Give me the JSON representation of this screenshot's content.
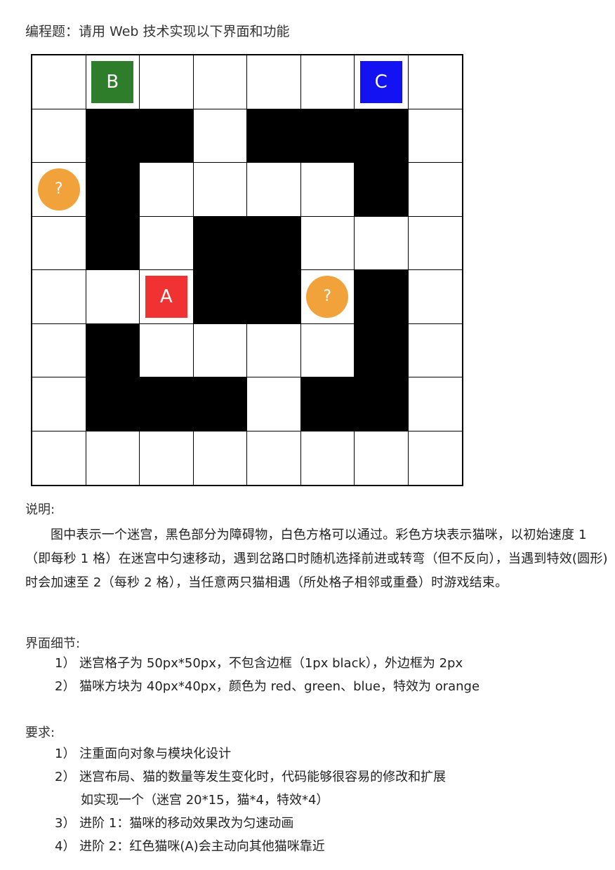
{
  "title": "编程题：请用 Web 技术实现以下界面和功能",
  "maze": {
    "rows": 8,
    "cols": 8,
    "walls": [
      [
        1,
        1
      ],
      [
        1,
        2
      ],
      [
        1,
        4
      ],
      [
        1,
        5
      ],
      [
        1,
        6
      ],
      [
        2,
        1
      ],
      [
        2,
        6
      ],
      [
        3,
        1
      ],
      [
        3,
        3
      ],
      [
        3,
        4
      ],
      [
        4,
        3
      ],
      [
        4,
        4
      ],
      [
        4,
        6
      ],
      [
        5,
        1
      ],
      [
        5,
        6
      ],
      [
        6,
        1
      ],
      [
        6,
        2
      ],
      [
        6,
        3
      ],
      [
        6,
        5
      ],
      [
        6,
        6
      ]
    ],
    "cats": [
      {
        "label": "B",
        "color": "#2E7D2A",
        "row": 0,
        "col": 1
      },
      {
        "label": "C",
        "color": "#1212F2",
        "row": 0,
        "col": 6
      },
      {
        "label": "A",
        "color": "#F03232",
        "row": 4,
        "col": 2
      }
    ],
    "effects": [
      {
        "label": "?",
        "color": "#F1A23A",
        "row": 2,
        "col": 0
      },
      {
        "label": "?",
        "color": "#F1A23A",
        "row": 4,
        "col": 5
      }
    ]
  },
  "description": {
    "heading": "说明:",
    "text": "图中表示一个迷宫，黑色部分为障碍物，白色方格可以通过。彩色方块表示猫咪，以初始速度 1（即每秒 1 格）在迷宫中匀速移动，遇到岔路口时随机选择前进或转弯（但不反向），当遇到特效(圆形)时会加速至 2（每秒 2 格），当任意两只猫相遇（所处格子相邻或重叠）时游戏结束。"
  },
  "ui_details": {
    "heading": "界面细节:",
    "items": [
      "1） 迷宫格子为 50px*50px，不包含边框（1px black），外边框为 2px",
      "2） 猫咪方块为 40px*40px，颜色为 red、green、blue，特效为 orange"
    ]
  },
  "requirements": {
    "heading": "要求:",
    "items": [
      "1） 注重面向对象与模块化设计",
      "2） 迷宫布局、猫的数量等发生变化时，代码能够很容易的修改和扩展",
      "如实现一个（迷宫 20*15，猫*4，特效*4）",
      "3） 进阶 1：猫咪的移动效果改为匀速动画",
      "4） 进阶 2：红色猫咪(A)会主动向其他猫咪靠近"
    ]
  }
}
